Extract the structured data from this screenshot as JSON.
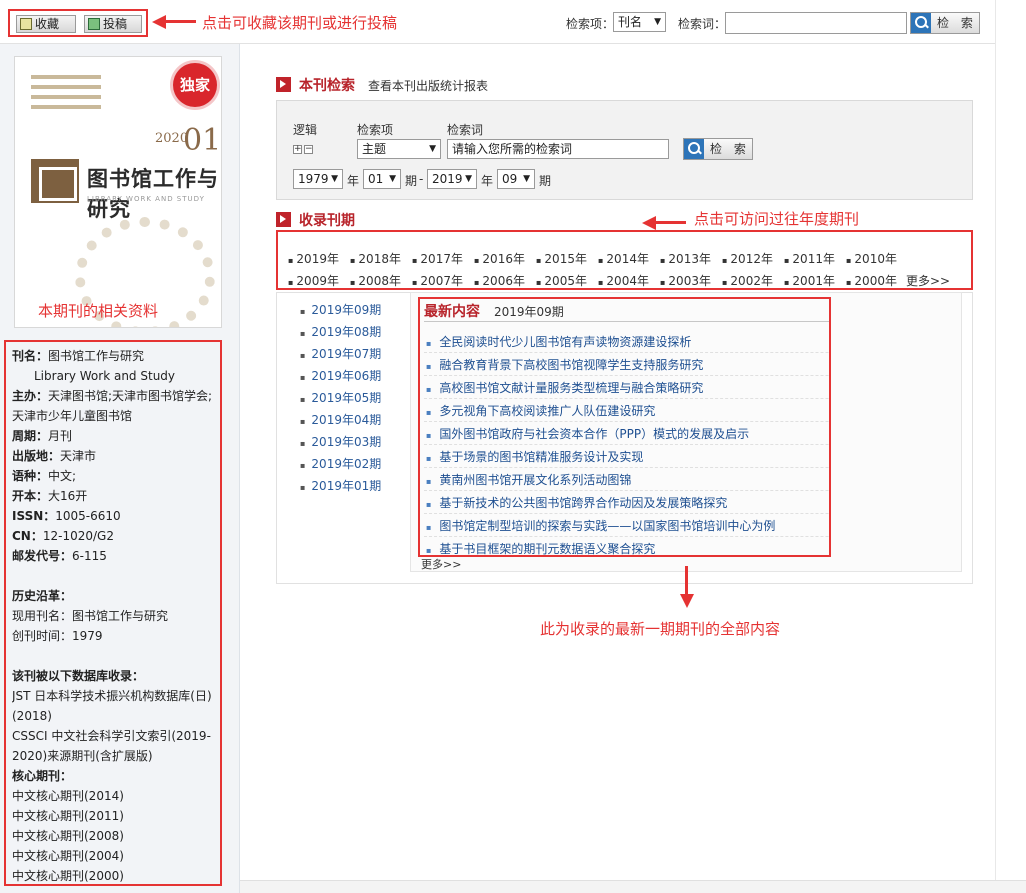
{
  "toolbar": {
    "favorite_label": "收藏",
    "contribute_label": "投稿",
    "annotation": "点击可收藏该期刊或进行投稿",
    "search_field_label": "检索项：",
    "search_field_value": "刊名",
    "search_term_label": "检索词：",
    "search_term_value": "",
    "search_button": "检 索"
  },
  "cover": {
    "badge": "独家",
    "year": "2020",
    "issue": "01",
    "title": "图书馆工作与研究",
    "subtitle": "LIBRARY WORK AND STUDY"
  },
  "left": {
    "annotation": "本期刊的相关资料",
    "info": {
      "title_label": "刊名：",
      "title_value": "图书馆工作与研究",
      "title_en": "Library Work and Study",
      "sponsor_label": "主办：",
      "sponsor_value": "天津图书馆;天津市图书馆学会;",
      "sponsor_value2": "天津市少年儿童图书馆",
      "period_label": "周期：",
      "period_value": "月刊",
      "place_label": "出版地：",
      "place_value": "天津市",
      "lang_label": "语种：",
      "lang_value": "中文;",
      "format_label": "开本：",
      "format_value": "大16开",
      "issn_label": "ISSN：",
      "issn_value": "1005-6610",
      "cn_label": "CN：",
      "cn_value": "12-1020/G2",
      "post_label": "邮发代号：",
      "post_value": "6-115",
      "history_label": "历史沿革：",
      "current_name": "现用刊名：图书馆工作与研究",
      "founded": "创刊时间：1979",
      "db_label": "该刊被以下数据库收录：",
      "db_jst": "JST 日本科学技术振兴机构数据库(日)(2018)",
      "db_cssci": "CSSCI 中文社会科学引文索引(2019-2020)来源期刊(含扩展版)",
      "core_label": "核心期刊：",
      "core_list": [
        "中文核心期刊(2014)",
        "中文核心期刊(2011)",
        "中文核心期刊(2008)",
        "中文核心期刊(2004)",
        "中文核心期刊(2000)"
      ]
    }
  },
  "journal_search": {
    "title": "本刊检索",
    "stats_link": "查看本刊出版统计报表",
    "logic_label": "逻辑",
    "field_label": "检索项",
    "term_label": "检索词",
    "field_value": "主题",
    "term_placeholder": "请输入您所需的检索词",
    "button": "检 索",
    "from_year": "1979",
    "year_char": "年",
    "from_issue": "01",
    "issue_char": "期",
    "dash": "-",
    "to_year": "2019",
    "to_issue": "09"
  },
  "collected": {
    "title": "收录刊期",
    "annotation": "点击可访问过往年度期刊",
    "years_row1": [
      "2019年",
      "2018年",
      "2017年",
      "2016年",
      "2015年",
      "2014年",
      "2013年",
      "2012年",
      "2011年",
      "2010年"
    ],
    "years_row2": [
      "2009年",
      "2008年",
      "2007年",
      "2006年",
      "2005年",
      "2004年",
      "2003年",
      "2002年",
      "2001年",
      "2000年"
    ],
    "more": "更多>>",
    "issues": [
      "2019年09期",
      "2019年08期",
      "2019年07期",
      "2019年06期",
      "2019年05期",
      "2019年04期",
      "2019年03期",
      "2019年02期",
      "2019年01期"
    ]
  },
  "latest": {
    "title": "最新内容",
    "issue": "2019年09期",
    "articles": [
      "全民阅读时代少儿图书馆有声读物资源建设探析",
      "融合教育背景下高校图书馆视障学生支持服务研究",
      "高校图书馆文献计量服务类型梳理与融合策略研究",
      "多元视角下高校阅读推广人队伍建设研究",
      "国外图书馆政府与社会资本合作（PPP）模式的发展及启示",
      "基于场景的图书馆精准服务设计及实现",
      "黄南州图书馆开展文化系列活动图锦",
      "基于新技术的公共图书馆跨界合作动因及发展策略探究",
      "图书馆定制型培训的探索与实践——以国家图书馆培训中心为例",
      "基于书目框架的期刊元数据语义聚合探究"
    ],
    "more": "更多>>",
    "annotation": "此为收录的最新一期期刊的全部内容"
  }
}
